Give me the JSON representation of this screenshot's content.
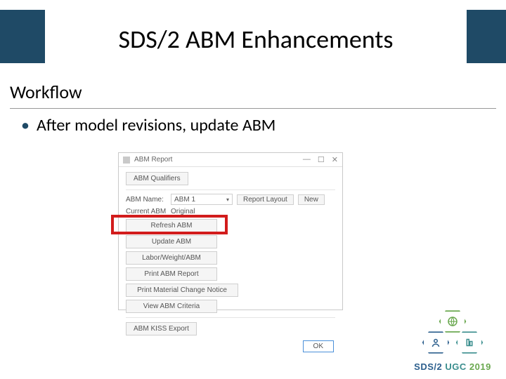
{
  "title": "SDS/2 ABM Enhancements",
  "section_heading": "Workflow",
  "bullet": "After model revisions, update ABM",
  "dialog": {
    "window_title": "ABM Report",
    "win_min": "—",
    "win_max": "☐",
    "win_close": "✕",
    "qualifiers_btn": "ABM Qualifiers",
    "name_label": "ABM Name:",
    "name_value": "ABM 1",
    "report_layout_btn": "Report Layout",
    "new_btn": "New",
    "current_label": "Current ABM",
    "current_value": "Original",
    "btn_refresh": "Refresh ABM",
    "btn_update": "Update ABM",
    "btn_labor": "Labor/Weight/ABM",
    "btn_print_report": "Print ABM Report",
    "btn_print_change": "Print Material Change Notice",
    "btn_view_criteria": "View ABM Criteria",
    "btn_kiss": "ABM KISS Export",
    "ok": "OK"
  },
  "footer": {
    "brand_1": "SDS/2",
    "brand_2": "UGC",
    "brand_3": "2019"
  }
}
